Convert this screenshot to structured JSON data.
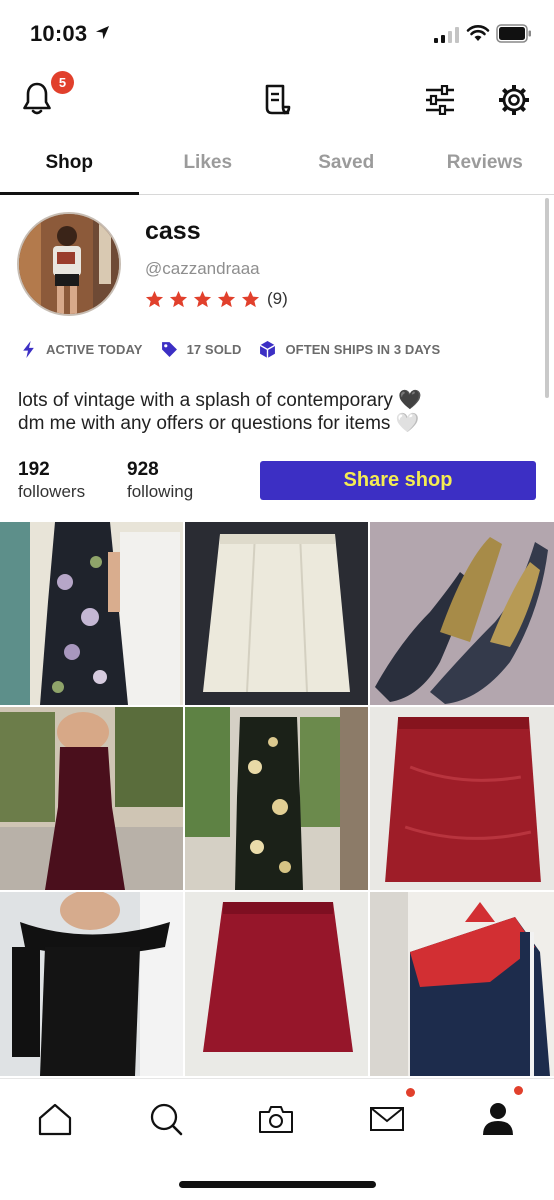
{
  "status_bar": {
    "time": "10:03"
  },
  "top_nav": {
    "notification_count": "5"
  },
  "tabs": [
    {
      "label": "Shop",
      "active": true
    },
    {
      "label": "Likes",
      "active": false
    },
    {
      "label": "Saved",
      "active": false
    },
    {
      "label": "Reviews",
      "active": false
    }
  ],
  "profile": {
    "name": "cass",
    "handle": "@cazzandraaa",
    "rating_stars": 5,
    "rating_count": "(9)",
    "badges": {
      "active": "ACTIVE TODAY",
      "sold": "17 SOLD",
      "ships": "OFTEN SHIPS IN 3 DAYS"
    },
    "bio_line1": "lots of vintage with a splash of contemporary 🖤",
    "bio_line2": "dm me with any offers or questions for items 🤍",
    "followers_count": "192",
    "followers_label": "followers",
    "following_count": "928",
    "following_label": "following",
    "share_label": "Share shop"
  },
  "colors": {
    "accent": "#3c2fc4",
    "share_text": "#f4ec52",
    "badge": "#e1402c",
    "star": "#e1402c",
    "badge_icon": "#3c2fc4"
  },
  "listings": [
    {
      "icon": "floral-dress-photo"
    },
    {
      "icon": "cream-skirt-photo"
    },
    {
      "icon": "snakeskin-heels-photo"
    },
    {
      "icon": "burgundy-gown-photo"
    },
    {
      "icon": "floral-slip-dress-photo"
    },
    {
      "icon": "red-suede-skirt-photo"
    },
    {
      "icon": "velvet-off-shoulder-dress-photo"
    },
    {
      "icon": "red-mini-skirt-photo"
    },
    {
      "icon": "track-jacket-photo"
    }
  ],
  "bottom_nav": [
    "home-icon",
    "search-icon",
    "camera-icon",
    "inbox-icon",
    "profile-icon"
  ]
}
